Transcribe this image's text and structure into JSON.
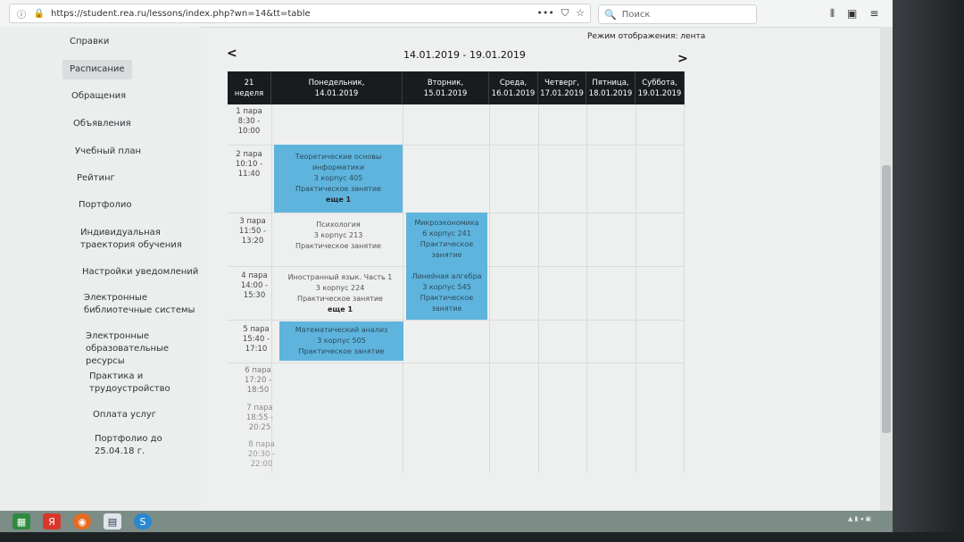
{
  "browser": {
    "url": "https://student.rea.ru/lessons/index.php?wn=14&tt=table",
    "search_placeholder": "Поиск"
  },
  "sidebar": {
    "items": [
      {
        "label": "Справки"
      },
      {
        "label": "Расписание"
      },
      {
        "label": "Обращения"
      },
      {
        "label": "Объявления"
      },
      {
        "label": "Учебный план"
      },
      {
        "label": "Рейтинг"
      },
      {
        "label": "Портфолио"
      },
      {
        "label": "Индивидуальная\nтраектория обучения"
      },
      {
        "label": "Настройки уведомлений"
      },
      {
        "label": "Электронные\nбиблиотечные системы"
      },
      {
        "label": "Электронные\nобразовательные ресурсы"
      },
      {
        "label": "Практика и\nтрудоустройство"
      },
      {
        "label": "Оплата услуг"
      },
      {
        "label": "Портфолио до 25.04.18 г."
      }
    ]
  },
  "schedule": {
    "mode_label": "Режим отображения: лента",
    "week_range": "14.01.2019 - 19.01.2019",
    "prev": "<",
    "next": ">",
    "week_header": {
      "line1": "21",
      "line2": "неделя"
    },
    "days": [
      {
        "line1": "Понедельник,",
        "line2": "14.01.2019"
      },
      {
        "line1": "Вторник,",
        "line2": "15.01.2019"
      },
      {
        "line1": "Среда,",
        "line2": "16.01.2019"
      },
      {
        "line1": "Четверг,",
        "line2": "17.01.2019"
      },
      {
        "line1": "Пятница,",
        "line2": "18.01.2019"
      },
      {
        "line1": "Суббота,",
        "line2": "19.01.2019"
      }
    ],
    "periods": [
      {
        "name": "1 пара",
        "start": "8:30 -",
        "end": "10:00"
      },
      {
        "name": "2 пара",
        "start": "10:10 -",
        "end": "11:40"
      },
      {
        "name": "3 пара",
        "start": "11:50 -",
        "end": "13:20"
      },
      {
        "name": "4 пара",
        "start": "14:00 -",
        "end": "15:30"
      },
      {
        "name": "5 пара",
        "start": "15:40 -",
        "end": "17:10"
      },
      {
        "name": "6 пара",
        "start": "17:20 -",
        "end": "18:50"
      },
      {
        "name": "7 пара",
        "start": "18:55 -",
        "end": "20:25"
      },
      {
        "name": "8 пара",
        "start": "20:30 -",
        "end": "22:00"
      }
    ],
    "lessons": [
      {
        "title": "Теоретические основы",
        "title2": "информатики",
        "room": "3 корпус 405",
        "type": "Практическое занятие",
        "more": "еще 1"
      },
      {
        "title": "Психология",
        "title2": "",
        "room": "3 корпус 213",
        "type": "Практическое занятие",
        "more": ""
      },
      {
        "title": "Микроэкономика",
        "title2": "",
        "room": "6 корпус 241",
        "type": "Практическое",
        "type2": "занятие",
        "more": ""
      },
      {
        "title": "Иностранный язык. Часть 1",
        "title2": "",
        "room": "3 корпус 224",
        "type": "Практическое занятие",
        "more": "еще 1"
      },
      {
        "title": "Линейная алгебра",
        "title2": "",
        "room": "3 корпус 545",
        "type": "Практическое",
        "type2": "занятие",
        "more": ""
      },
      {
        "title": "Математический анализ",
        "title2": "",
        "room": "3 корпус 505",
        "type": "Практическое занятие",
        "more": ""
      }
    ]
  }
}
